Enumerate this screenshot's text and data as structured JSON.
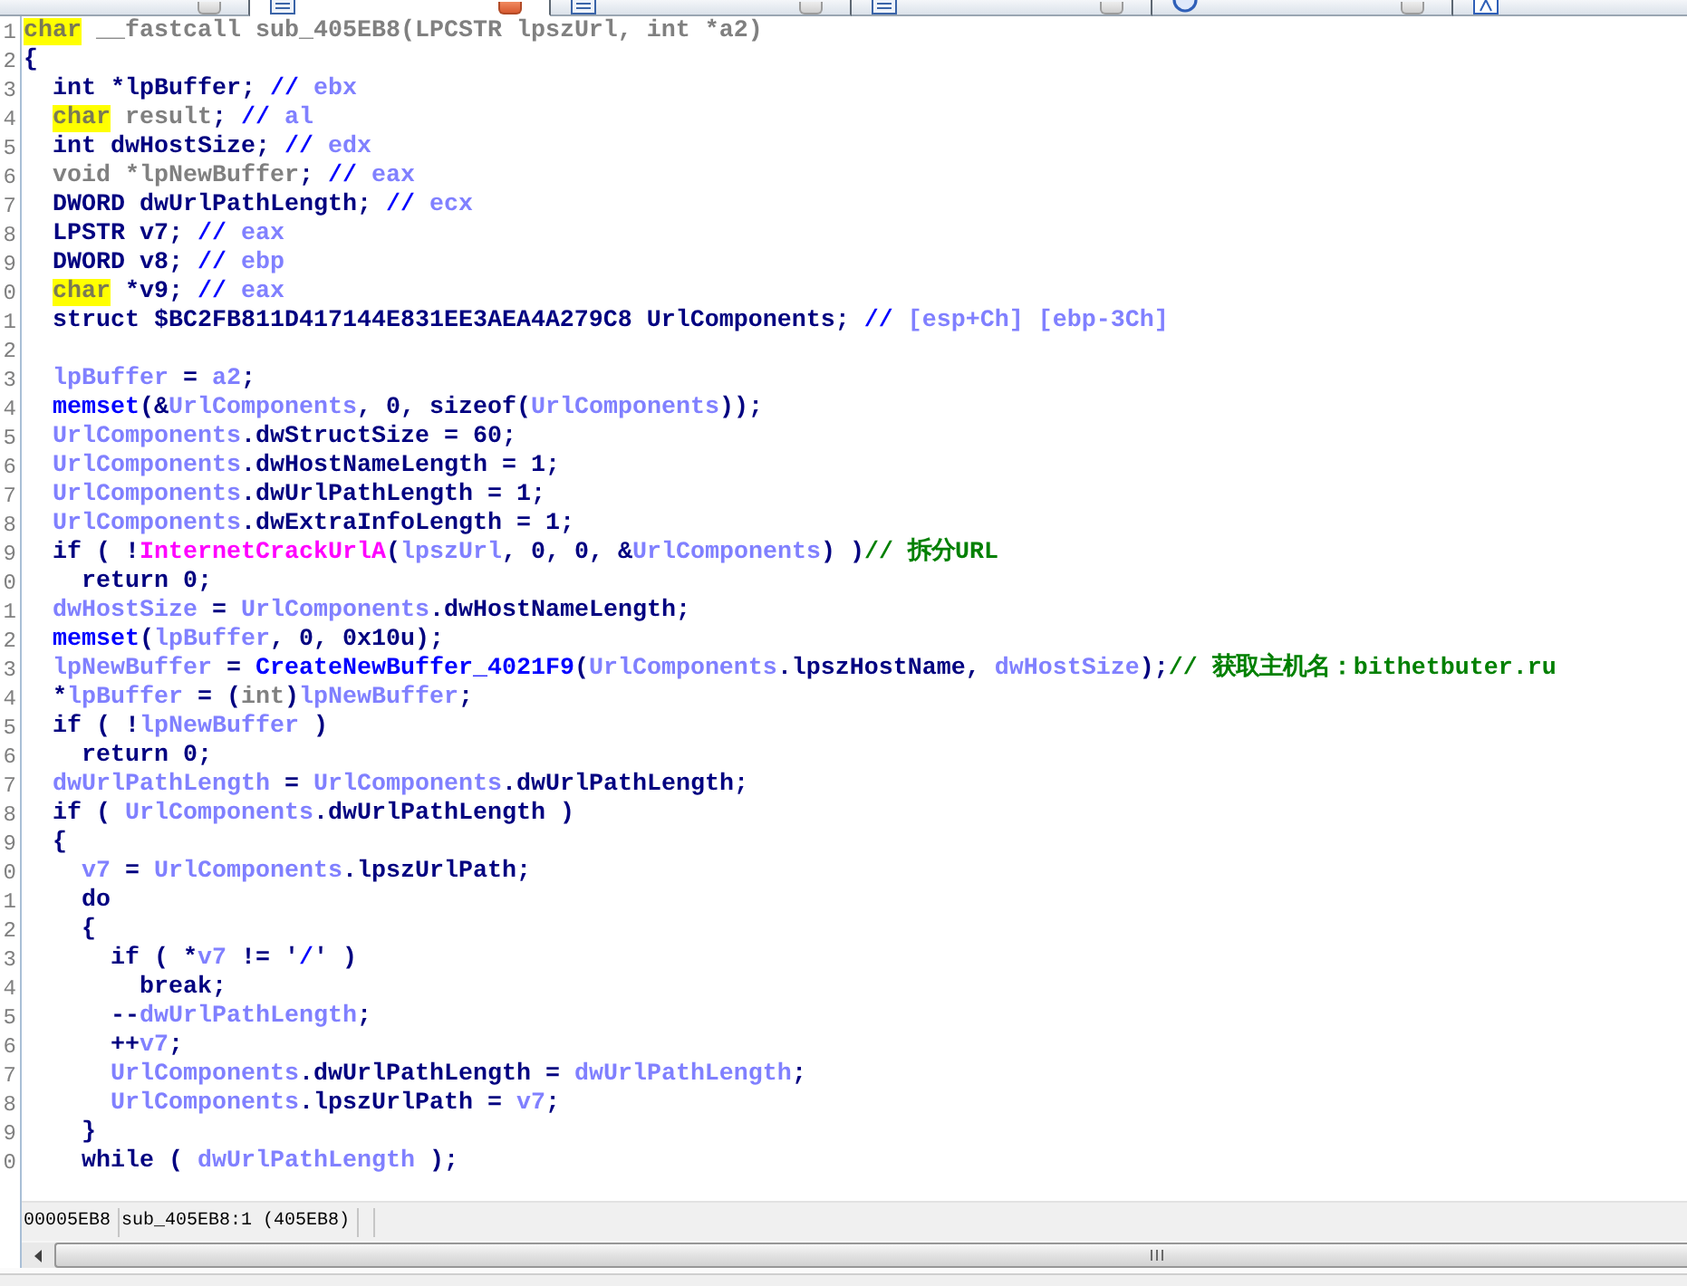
{
  "tabs": [
    {
      "selected": false,
      "close_button": true
    },
    {
      "kind": "pseudocode",
      "selected": true,
      "close_button": true
    },
    {
      "kind": "pseudocode",
      "selected": false,
      "close_button": true
    },
    {
      "kind": "pseudocode",
      "selected": false,
      "close_button": true
    },
    {
      "kind": "hex",
      "selected": false,
      "close_button": true
    },
    {
      "kind": "structures",
      "selected": false
    }
  ],
  "code": {
    "lines": [
      {
        "number": "1",
        "tokens": [
          {
            "kind": "highlight",
            "text": "char"
          },
          {
            "kind": "dim",
            "text": " __fastcall sub_405EB8(LPCSTR lpszUrl, int *a2)"
          }
        ]
      },
      {
        "number": "2",
        "tokens": [
          {
            "kind": "plain",
            "text": "{"
          }
        ]
      },
      {
        "number": "3",
        "tokens": [
          {
            "kind": "plain",
            "text": "  int *lpBuffer; "
          },
          {
            "kind": "mark",
            "text": "//"
          },
          {
            "kind": "var",
            "text": " ebx"
          }
        ]
      },
      {
        "number": "4",
        "tokens": [
          {
            "kind": "highlight",
            "text": "  char"
          },
          {
            "kind": "dim",
            "text": " result"
          },
          {
            "kind": "plain",
            "text": "; "
          },
          {
            "kind": "mark",
            "text": "//"
          },
          {
            "kind": "var",
            "text": " al"
          }
        ]
      },
      {
        "number": "5",
        "tokens": [
          {
            "kind": "plain",
            "text": "  int dwHostSize; "
          },
          {
            "kind": "mark",
            "text": "//"
          },
          {
            "kind": "var",
            "text": " edx"
          }
        ]
      },
      {
        "number": "6",
        "tokens": [
          {
            "kind": "dim",
            "text": "  void *lpNewBuffer"
          },
          {
            "kind": "plain",
            "text": "; "
          },
          {
            "kind": "mark",
            "text": "//"
          },
          {
            "kind": "var",
            "text": " eax"
          }
        ]
      },
      {
        "number": "7",
        "tokens": [
          {
            "kind": "plain",
            "text": "  DWORD dwUrlPathLength; "
          },
          {
            "kind": "mark",
            "text": "//"
          },
          {
            "kind": "var",
            "text": " ecx"
          }
        ]
      },
      {
        "number": "8",
        "tokens": [
          {
            "kind": "plain",
            "text": "  LPSTR v7; "
          },
          {
            "kind": "mark",
            "text": "//"
          },
          {
            "kind": "var",
            "text": " eax"
          }
        ]
      },
      {
        "number": "9",
        "tokens": [
          {
            "kind": "plain",
            "text": "  DWORD v8; "
          },
          {
            "kind": "mark",
            "text": "//"
          },
          {
            "kind": "var",
            "text": " ebp"
          }
        ]
      },
      {
        "number": "0",
        "tokens": [
          {
            "kind": "highlight",
            "text": "  char"
          },
          {
            "kind": "plain",
            "text": " *v9; "
          },
          {
            "kind": "mark",
            "text": "//"
          },
          {
            "kind": "var",
            "text": " eax"
          }
        ]
      },
      {
        "number": "1",
        "tokens": [
          {
            "kind": "plain",
            "text": "  struct $BC2FB811D417144E831EE3AEA4A279C8 UrlComponents; "
          },
          {
            "kind": "mark",
            "text": "//"
          },
          {
            "kind": "var",
            "text": " [esp+Ch] [ebp-3Ch]"
          }
        ]
      },
      {
        "number": "2"
      },
      {
        "number": "3",
        "tokens": [
          {
            "kind": "var",
            "text": "  lpBuffer"
          },
          {
            "kind": "plain",
            "text": " = "
          },
          {
            "kind": "var",
            "text": "a2"
          },
          {
            "kind": "plain",
            "text": ";"
          }
        ]
      },
      {
        "number": "4",
        "tokens": [
          {
            "kind": "func",
            "text": "  memset"
          },
          {
            "kind": "plain",
            "text": "(&"
          },
          {
            "kind": "var",
            "text": "UrlComponents"
          },
          {
            "kind": "plain",
            "text": ", 0, sizeof("
          },
          {
            "kind": "var",
            "text": "UrlComponents"
          },
          {
            "kind": "plain",
            "text": "));"
          }
        ]
      },
      {
        "number": "5",
        "tokens": [
          {
            "kind": "var",
            "text": "  UrlComponents"
          },
          {
            "kind": "plain",
            "text": ".dwStructSize = 60;"
          }
        ]
      },
      {
        "number": "6",
        "tokens": [
          {
            "kind": "var",
            "text": "  UrlComponents"
          },
          {
            "kind": "plain",
            "text": ".dwHostNameLength = 1;"
          }
        ]
      },
      {
        "number": "7",
        "tokens": [
          {
            "kind": "var",
            "text": "  UrlComponents"
          },
          {
            "kind": "plain",
            "text": ".dwUrlPathLength = 1;"
          }
        ]
      },
      {
        "number": "8",
        "tokens": [
          {
            "kind": "var",
            "text": "  UrlComponents"
          },
          {
            "kind": "plain",
            "text": ".dwExtraInfoLength = 1;"
          }
        ]
      },
      {
        "number": "9",
        "tokens": [
          {
            "kind": "plain",
            "text": "  if ( !"
          },
          {
            "kind": "import",
            "text": "InternetCrackUrlA"
          },
          {
            "kind": "plain",
            "text": "("
          },
          {
            "kind": "var",
            "text": "lpszUrl"
          },
          {
            "kind": "plain",
            "text": ", 0, 0, &"
          },
          {
            "kind": "var",
            "text": "UrlComponents"
          },
          {
            "kind": "plain",
            "text": ") )"
          },
          {
            "kind": "note",
            "text": "// 拆分URL"
          }
        ]
      },
      {
        "number": "0",
        "tokens": [
          {
            "kind": "plain",
            "text": "    return 0;"
          }
        ]
      },
      {
        "number": "1",
        "tokens": [
          {
            "kind": "var",
            "text": "  dwHostSize"
          },
          {
            "kind": "plain",
            "text": " = "
          },
          {
            "kind": "var",
            "text": "UrlComponents"
          },
          {
            "kind": "plain",
            "text": ".dwHostNameLength;"
          }
        ]
      },
      {
        "number": "2",
        "tokens": [
          {
            "kind": "func",
            "text": "  memset"
          },
          {
            "kind": "plain",
            "text": "("
          },
          {
            "kind": "var",
            "text": "lpBuffer"
          },
          {
            "kind": "plain",
            "text": ", 0, 0x10u);"
          }
        ]
      },
      {
        "number": "3",
        "tokens": [
          {
            "kind": "var",
            "text": "  lpNewBuffer"
          },
          {
            "kind": "plain",
            "text": " = "
          },
          {
            "kind": "func",
            "text": "CreateNewBuffer_4021F9"
          },
          {
            "kind": "plain",
            "text": "("
          },
          {
            "kind": "var",
            "text": "UrlComponents"
          },
          {
            "kind": "plain",
            "text": ".lpszHostName, "
          },
          {
            "kind": "var",
            "text": "dwHostSize"
          },
          {
            "kind": "plain",
            "text": ");"
          },
          {
            "kind": "note",
            "text": "// 获取主机名：bithetbuter.ru"
          }
        ]
      },
      {
        "number": "4",
        "tokens": [
          {
            "kind": "plain",
            "text": "  *"
          },
          {
            "kind": "var",
            "text": "lpBuffer"
          },
          {
            "kind": "plain",
            "text": " = ("
          },
          {
            "kind": "dim",
            "text": "int"
          },
          {
            "kind": "plain",
            "text": ")"
          },
          {
            "kind": "var",
            "text": "lpNewBuffer"
          },
          {
            "kind": "plain",
            "text": ";"
          }
        ]
      },
      {
        "number": "5",
        "tokens": [
          {
            "kind": "plain",
            "text": "  if ( !"
          },
          {
            "kind": "var",
            "text": "lpNewBuffer"
          },
          {
            "kind": "plain",
            "text": " )"
          }
        ]
      },
      {
        "number": "6",
        "tokens": [
          {
            "kind": "plain",
            "text": "    return 0;"
          }
        ]
      },
      {
        "number": "7",
        "tokens": [
          {
            "kind": "var",
            "text": "  dwUrlPathLength"
          },
          {
            "kind": "plain",
            "text": " = "
          },
          {
            "kind": "var",
            "text": "UrlComponents"
          },
          {
            "kind": "plain",
            "text": ".dwUrlPathLength;"
          }
        ]
      },
      {
        "number": "8",
        "tokens": [
          {
            "kind": "plain",
            "text": "  if ( "
          },
          {
            "kind": "var",
            "text": "UrlComponents"
          },
          {
            "kind": "plain",
            "text": ".dwUrlPathLength )"
          }
        ]
      },
      {
        "number": "9",
        "tokens": [
          {
            "kind": "plain",
            "text": "  {"
          }
        ]
      },
      {
        "number": "0",
        "tokens": [
          {
            "kind": "var",
            "text": "    v7"
          },
          {
            "kind": "plain",
            "text": " = "
          },
          {
            "kind": "var",
            "text": "UrlComponents"
          },
          {
            "kind": "plain",
            "text": ".lpszUrlPath;"
          }
        ]
      },
      {
        "number": "1",
        "tokens": [
          {
            "kind": "plain",
            "text": "    do"
          }
        ]
      },
      {
        "number": "2",
        "tokens": [
          {
            "kind": "plain",
            "text": "    {"
          }
        ]
      },
      {
        "number": "3",
        "tokens": [
          {
            "kind": "plain",
            "text": "      if ( *"
          },
          {
            "kind": "var",
            "text": "v7"
          },
          {
            "kind": "plain",
            "text": " != '"
          },
          {
            "kind": "mark",
            "text": "/"
          },
          {
            "kind": "plain",
            "text": "' )"
          }
        ]
      },
      {
        "number": "4",
        "tokens": [
          {
            "kind": "plain",
            "text": "        break;"
          }
        ]
      },
      {
        "number": "5",
        "tokens": [
          {
            "kind": "plain",
            "text": "      --"
          },
          {
            "kind": "var",
            "text": "dwUrlPathLength"
          },
          {
            "kind": "plain",
            "text": ";"
          }
        ]
      },
      {
        "number": "6",
        "tokens": [
          {
            "kind": "plain",
            "text": "      ++"
          },
          {
            "kind": "var",
            "text": "v7"
          },
          {
            "kind": "plain",
            "text": ";"
          }
        ]
      },
      {
        "number": "7",
        "tokens": [
          {
            "kind": "var",
            "text": "      UrlComponents"
          },
          {
            "kind": "plain",
            "text": ".dwUrlPathLength = "
          },
          {
            "kind": "var",
            "text": "dwUrlPathLength"
          },
          {
            "kind": "plain",
            "text": ";"
          }
        ]
      },
      {
        "number": "8",
        "tokens": [
          {
            "kind": "var",
            "text": "      UrlComponents"
          },
          {
            "kind": "plain",
            "text": ".lpszUrlPath = "
          },
          {
            "kind": "var",
            "text": "v7"
          },
          {
            "kind": "plain",
            "text": ";"
          }
        ]
      },
      {
        "number": "9",
        "tokens": [
          {
            "kind": "plain",
            "text": "    }"
          }
        ]
      },
      {
        "number": "0",
        "tokens": [
          {
            "kind": "plain",
            "text": "    while ( "
          },
          {
            "kind": "var",
            "text": "dwUrlPathLength"
          },
          {
            "kind": "plain",
            "text": " );"
          }
        ]
      }
    ]
  },
  "status_bar": [
    "00005EB8",
    "sub_405EB8:1 (405EB8)"
  ]
}
